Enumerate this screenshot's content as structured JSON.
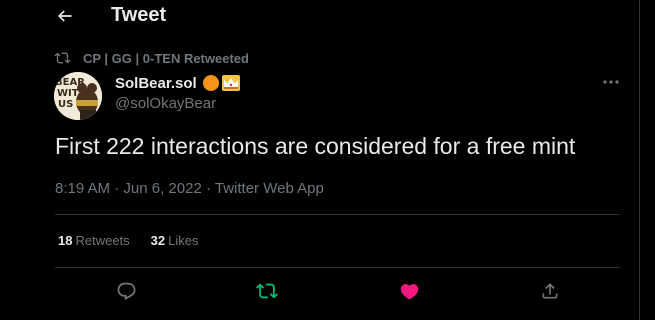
{
  "header": {
    "title": "Tweet",
    "back_icon": "arrow-left-icon"
  },
  "social_context": {
    "icon": "retweet-icon",
    "text": "CP | GG | 0-TEN Retweeted"
  },
  "author": {
    "display_name": "SolBear.sol",
    "handle": "@solOkayBear",
    "badges": [
      "orange-circle-badge",
      "crown-badge"
    ],
    "avatar_text": [
      "BEAR",
      "WITH",
      "US"
    ]
  },
  "tweet": {
    "text": "First 222 interactions are considered for a free mint",
    "time": "8:19 AM",
    "separator": "·",
    "date": "Jun 6, 2022",
    "source": "Twitter Web App"
  },
  "stats": {
    "retweets_count": "18",
    "retweets_label": "Retweets",
    "likes_count": "32",
    "likes_label": "Likes"
  },
  "actions": {
    "reply": "reply-icon",
    "retweet": "retweet-icon",
    "like": "heart-icon",
    "share": "share-icon"
  },
  "colors": {
    "background": "#000000",
    "text": "#e7e9ea",
    "secondary": "#71767b",
    "divider": "#2f3336",
    "retweet_active": "#00ba7c",
    "like_active": "#f91880",
    "badge_orange": "#f7931a"
  }
}
